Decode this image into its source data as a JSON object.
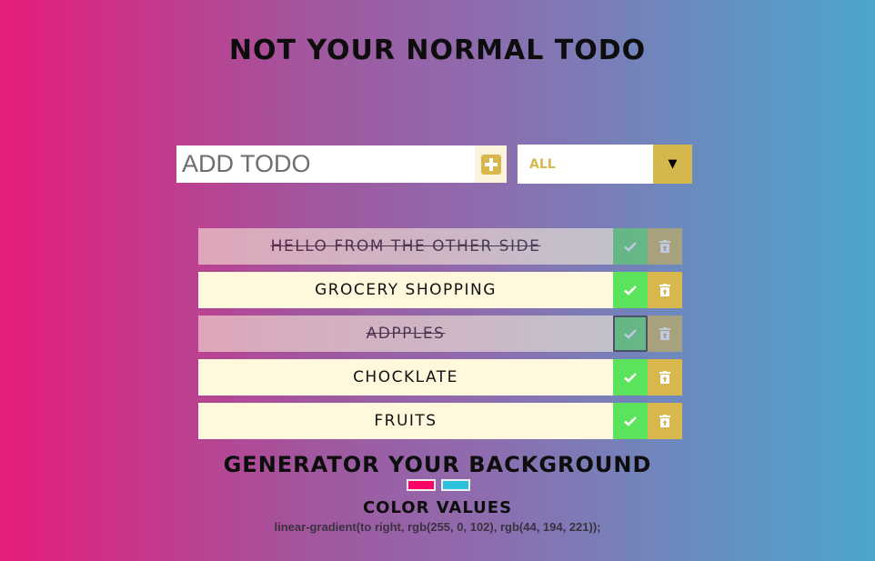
{
  "header": {
    "title": "NOT YOUR NORMAL TODO"
  },
  "add_form": {
    "placeholder": "ADD TODO",
    "value": "",
    "add_icon": "plus-square-icon"
  },
  "filter": {
    "selected": "ALL",
    "arrow_icon": "caret-down-icon"
  },
  "todos": [
    {
      "text": "HELLO FROM THE OTHER SIDE",
      "completed": true
    },
    {
      "text": "GROCERY SHOPPING",
      "completed": false
    },
    {
      "text": "ADPPLES",
      "completed": true
    },
    {
      "text": "CHOCKLATE",
      "completed": false
    },
    {
      "text": "FRUITS",
      "completed": false
    }
  ],
  "generator": {
    "title": "GENERATOR YOUR BACKGROUND",
    "color1": "#ff0066",
    "color2": "#2cc2dd",
    "values_title": "COLOR VALUES",
    "css_value": "linear-gradient(to right, rgb(255, 0, 102), rgb(44, 194, 221));"
  },
  "colors": {
    "accent_yellow": "#d8b84c",
    "check_green": "#5be35b",
    "item_bg": "#fff8dc"
  }
}
